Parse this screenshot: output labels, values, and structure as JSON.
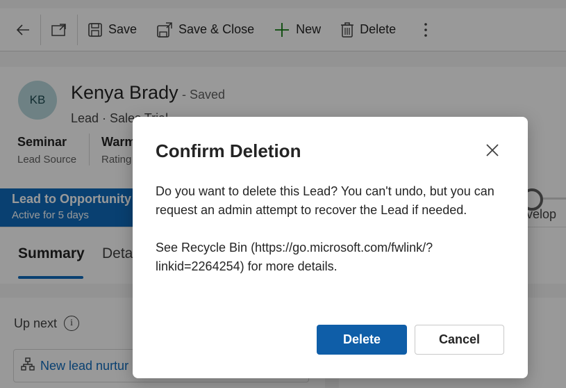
{
  "toolbar": {
    "back_icon": "back-arrow-icon",
    "open_icon": "open-in-new-window-icon",
    "save_label": "Save",
    "save_close_label": "Save & Close",
    "new_label": "New",
    "delete_label": "Delete",
    "more_icon": "more-vertical-icon"
  },
  "record": {
    "initials": "KB",
    "name": "Kenya Brady",
    "status": "- Saved",
    "entity_line": "Lead  ·  Sales Trial",
    "fields": [
      {
        "value": "Seminar",
        "label": "Lead Source"
      },
      {
        "value": "Warm",
        "label": "Rating"
      }
    ]
  },
  "bpf": {
    "stage_title": "Lead to Opportunity",
    "stage_sub": "Active for 5 days",
    "next_stage": "evelop"
  },
  "tabs": [
    {
      "label": "Summary",
      "active": true
    },
    {
      "label": "Deta",
      "active": false
    }
  ],
  "upnext": {
    "title": "Up next",
    "item": "New lead nurtur"
  },
  "dialog": {
    "title": "Confirm Deletion",
    "body1": "Do you want to delete this Lead? You can't undo, but you can request an admin attempt to recover the Lead if needed.",
    "body2": "See Recycle Bin (https://go.microsoft.com/fwlink/?linkid=2264254) for more details.",
    "confirm_label": "Delete",
    "cancel_label": "Cancel"
  },
  "colors": {
    "accent": "#0f6cbd",
    "primary_button": "#0f5ea8",
    "overlay": "rgba(0,0,0,0.4)"
  }
}
